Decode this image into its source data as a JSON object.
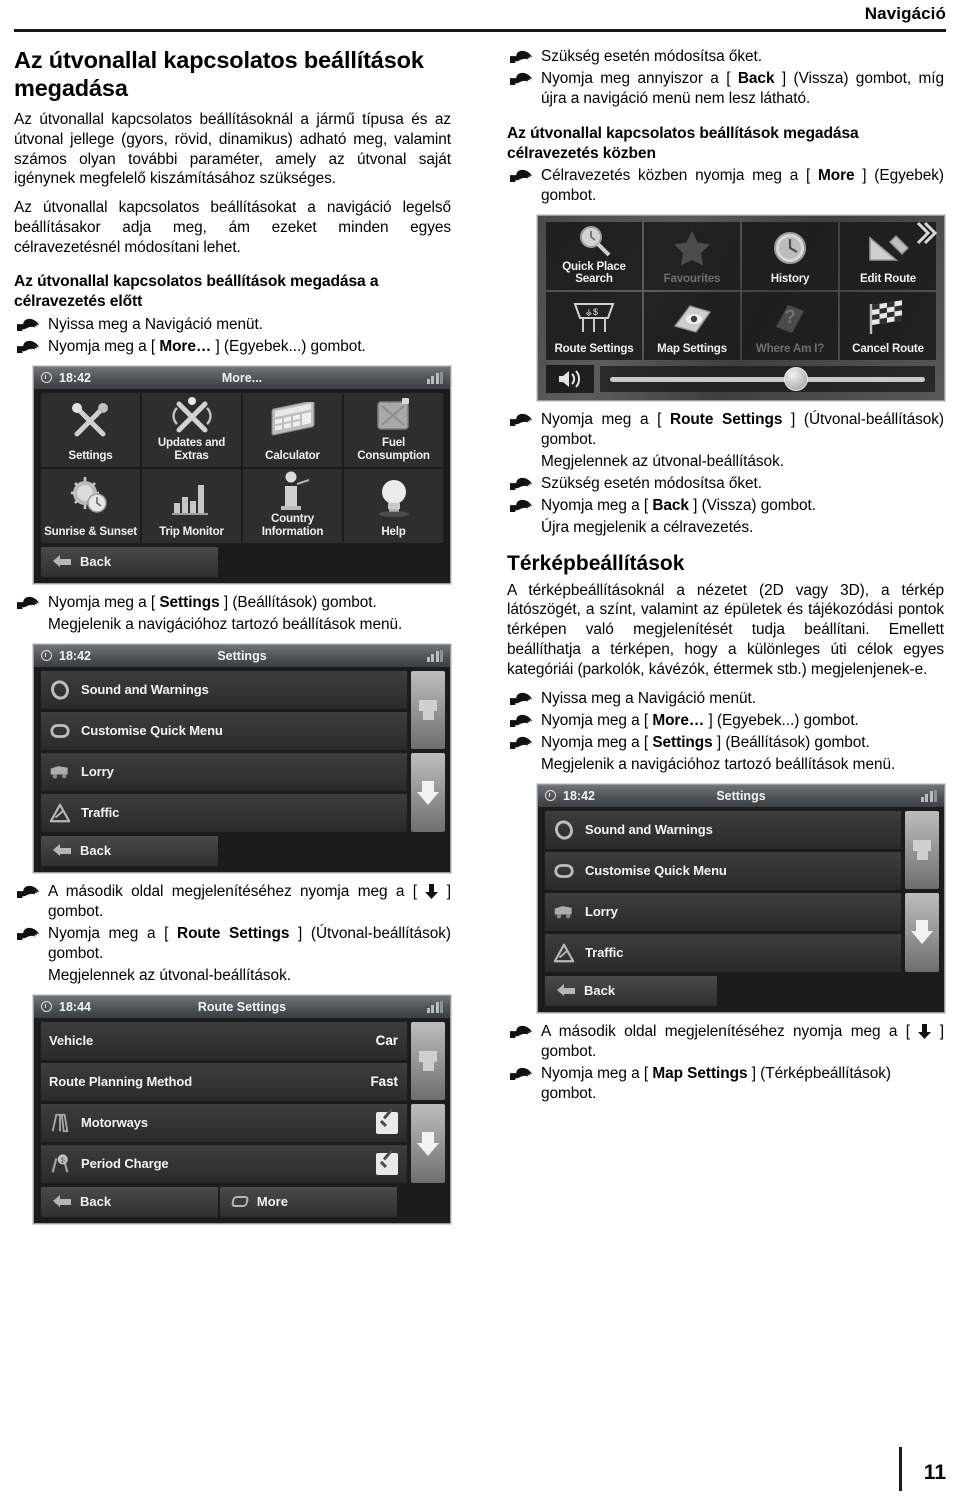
{
  "runninghead": {
    "title": "Navigáció"
  },
  "page": {
    "number": "11"
  },
  "left": {
    "heading": "Az útvonallal kapcsolatos beállítások megadása",
    "para1": "Az útvonallal kapcsolatos beállításoknál a jármű típusa és az útvonal jellege (gyors, rövid, dinamikus) adható meg, valamint számos olyan további paraméter, amely az útvonal saját igénynek megfelelő kiszámításához szükséges.",
    "para2": "Az útvonallal kapcsolatos beállításokat a navigáció legelső beállításakor adja meg, ám ezeket minden egyes célravezetésnél módosítani lehet.",
    "subheading": "Az útvonallal kapcsolatos beállítások megadása a célravezetés előtt",
    "step1": "Nyissa meg a Navigáció menüt.",
    "step2_pre": "Nyomja meg a [ ",
    "step2_kb": "More…",
    "step2_post": " ] (Egyebek...) gombot.",
    "step3_pre": "Nyomja meg a [ ",
    "step3_kb": "Settings",
    "step3_post": " ] (Beállítások) gombot.",
    "note3": "Megjelenik a navigációhoz tartozó beállítások menü.",
    "step4_pre": "A második oldal megjelenítéséhez nyomja meg a [ ",
    "step4_post": " ] gombot.",
    "step5_pre": "Nyomja meg a [ ",
    "step5_kb": "Route Settings",
    "step5_post": " ] (Útvonal-beállítások) gombot.",
    "note5": "Megjelennek az útvonal-beállítások."
  },
  "right": {
    "step1": "Szükség esetén módosítsa őket.",
    "step2_pre": "Nyomja meg annyiszor a [ ",
    "step2_kb": "Back",
    "step2_post": " ] (Vissza) gombot, míg újra a navigáció menü nem lesz látható.",
    "subheading": "Az útvonallal kapcsolatos beállítások megadása célravezetés közben",
    "step3_pre": "Célravezetés közben nyomja meg a [ ",
    "step3_kb": "More",
    "step3_post": " ] (Egyebek) gombot.",
    "step4_pre": "Nyomja meg a [ ",
    "step4_kb": "Route Settings",
    "step4_post": " ] (Útvonal-beállítások) gombot.",
    "note4": "Megjelennek az útvonal-beállítások.",
    "step5": "Szükség esetén módosítsa őket.",
    "step6_pre": "Nyomja meg a [ ",
    "step6_kb": "Back",
    "step6_post": " ] (Vissza) gombot.",
    "note6": "Újra megjelenik a célravezetés.",
    "heading2": "Térképbeállítások",
    "para1": "A térképbeállításoknál a nézetet (2D vagy 3D), a térkép látószögét, a színt, valamint az épületek és tájékozódási pontok térképen való megjelenítését tudja beállítani. Emellett beállíthatja a térképen, hogy a különleges úti célok egyes kategóriái (parkolók, kávézók, éttermek stb.) megjelenjenek-e.",
    "step7": "Nyissa meg a Navigáció menüt.",
    "step8_pre": "Nyomja meg a [ ",
    "step8_kb": "More…",
    "step8_post": " ] (Egyebek...) gombot.",
    "step9_pre": "Nyomja meg a [ ",
    "step9_kb": "Settings",
    "step9_post": " ] (Beállítások) gombot.",
    "note9": "Megjelenik a navigációhoz tartozó beállítások menü.",
    "step10_pre": "A második oldal megjelenítéséhez nyomja meg a [ ",
    "step10_post": " ] gombot.",
    "step11_pre": "Nyomja meg a [ ",
    "step11_kb": "Map Settings",
    "step11_post": " ] (Térképbeállítások) gombot."
  },
  "shots": {
    "more_menu": {
      "time": "18:42",
      "title": "More...",
      "tiles": [
        {
          "label": "Settings",
          "icon": "tools-icon"
        },
        {
          "label": "Updates and Extras",
          "icon": "updates-icon"
        },
        {
          "label": "Calculator",
          "icon": "calculator-icon"
        },
        {
          "label": "Fuel Consumption",
          "icon": "fuel-can-icon"
        },
        {
          "label": "Sunrise & Sunset",
          "icon": "sunrise-sunset-icon"
        },
        {
          "label": "Trip Monitor",
          "icon": "bar-chart-icon"
        },
        {
          "label": "Country Information",
          "icon": "info-icon"
        },
        {
          "label": "Help",
          "icon": "lightbulb-icon"
        }
      ],
      "back": "Back"
    },
    "settings_list": {
      "time": "18:42",
      "title": "Settings",
      "rows": [
        {
          "label": "Sound and Warnings",
          "icon": "speaker-icon"
        },
        {
          "label": "Customise Quick Menu",
          "icon": "quickmenu-icon"
        },
        {
          "label": "Lorry",
          "icon": "lorry-icon"
        },
        {
          "label": "Traffic",
          "icon": "traffic-warning-icon"
        }
      ],
      "back": "Back"
    },
    "route_settings": {
      "time": "18:44",
      "title": "Route Settings",
      "rows": [
        {
          "label": "Vehicle",
          "value": "Car",
          "type": "value"
        },
        {
          "label": "Route Planning Method",
          "value": "Fast",
          "type": "value"
        },
        {
          "label": "Motorways",
          "value": "",
          "type": "check",
          "icon": "motorway-icon"
        },
        {
          "label": "Period Charge",
          "value": "",
          "type": "check",
          "icon": "period-charge-icon"
        }
      ],
      "back": "Back",
      "more": "More"
    },
    "nav_menu": {
      "tiles": [
        {
          "label": "Quick Place Search",
          "icon": "magnifier-icon",
          "dim": false
        },
        {
          "label": "Favourites",
          "icon": "star-icon",
          "dim": true
        },
        {
          "label": "History",
          "icon": "clock-icon",
          "dim": false
        },
        {
          "label": "Edit Route",
          "icon": "ruler-icon",
          "dim": false
        },
        {
          "label": "Route Settings",
          "icon": "signpost-icon",
          "dim": false
        },
        {
          "label": "Map Settings",
          "icon": "map-eye-icon",
          "dim": false
        },
        {
          "label": "Where Am I?",
          "icon": "question-map-icon",
          "dim": true
        },
        {
          "label": "Cancel Route",
          "icon": "checkered-flag-icon",
          "dim": false
        }
      ]
    }
  }
}
